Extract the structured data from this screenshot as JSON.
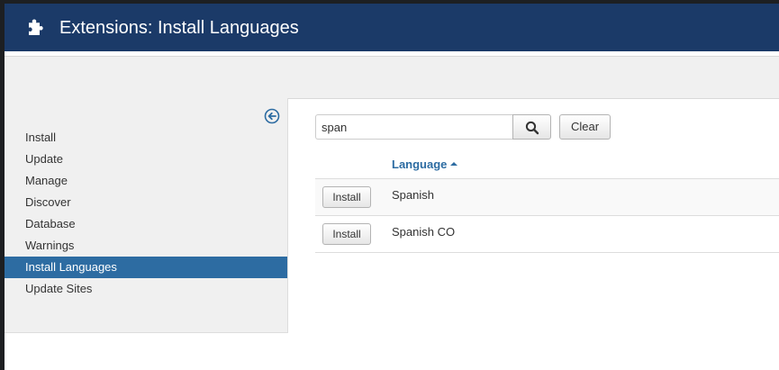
{
  "header": {
    "title": "Extensions: Install Languages",
    "icon": "puzzle-icon",
    "background": "#1b3a68"
  },
  "sidebar": {
    "collapse_icon": "arrow-left-circle-icon",
    "items": [
      {
        "label": "Install",
        "active": false
      },
      {
        "label": "Update",
        "active": false
      },
      {
        "label": "Manage",
        "active": false
      },
      {
        "label": "Discover",
        "active": false
      },
      {
        "label": "Database",
        "active": false
      },
      {
        "label": "Warnings",
        "active": false
      },
      {
        "label": "Install Languages",
        "active": true
      },
      {
        "label": "Update Sites",
        "active": false
      }
    ],
    "active_color": "#2d6ca2"
  },
  "search": {
    "value": "span",
    "button_icon": "search-icon",
    "clear_label": "Clear"
  },
  "table": {
    "column_header": "Language",
    "sort": "ascending",
    "rows": [
      {
        "install_label": "Install",
        "language": "Spanish"
      },
      {
        "install_label": "Install",
        "language": "Spanish CO"
      }
    ]
  }
}
